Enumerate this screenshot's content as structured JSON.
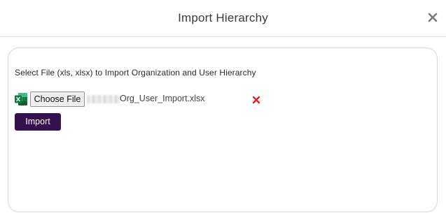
{
  "dialog": {
    "title": "Import Hierarchy",
    "close_icon": "close-icon"
  },
  "body": {
    "instruction": "Select File (xls, xlsx) to Import Organization and User Hierarchy",
    "file_input": {
      "icon": "excel-icon",
      "button_label": "Choose File",
      "file_name": "Org_User_Import.xlsx",
      "remove_icon": "remove-file-icon",
      "remove_color": "#e0202a"
    },
    "import_label": "Import",
    "accent_color": "#33104e"
  }
}
